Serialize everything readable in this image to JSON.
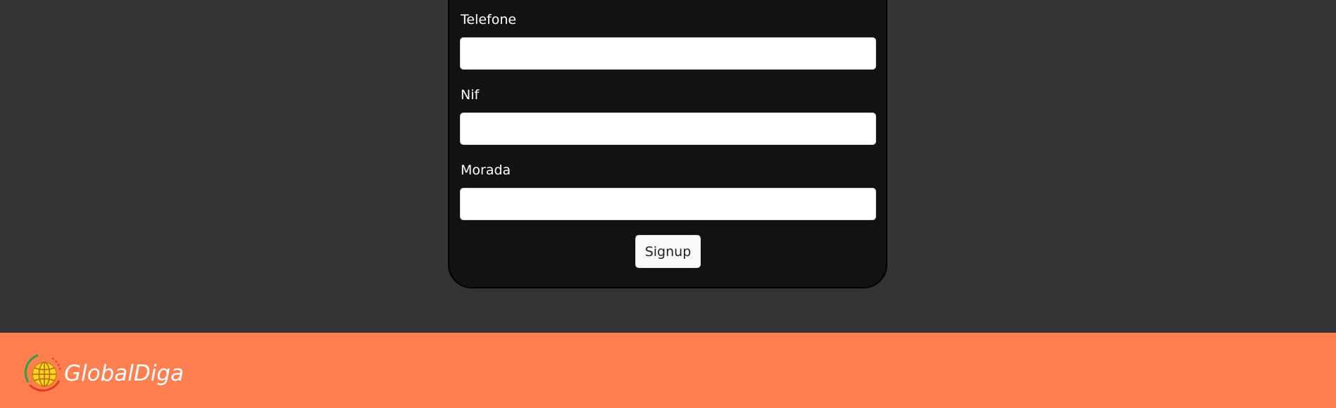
{
  "form": {
    "fields": [
      {
        "label": "Telefone",
        "value": ""
      },
      {
        "label": "Nif",
        "value": ""
      },
      {
        "label": "Morada",
        "value": ""
      }
    ],
    "submit_label": "Signup"
  },
  "footer": {
    "brand": "GlobalDiga",
    "logo_icon": "globe-logo-icon"
  },
  "colors": {
    "page_bg": "#343434",
    "card_bg": "#121212",
    "footer_bg": "#ff7f50",
    "logo_globe": "#ffd21f",
    "logo_arc_green": "#2e9e3f",
    "logo_arc_red": "#e53a1e"
  }
}
